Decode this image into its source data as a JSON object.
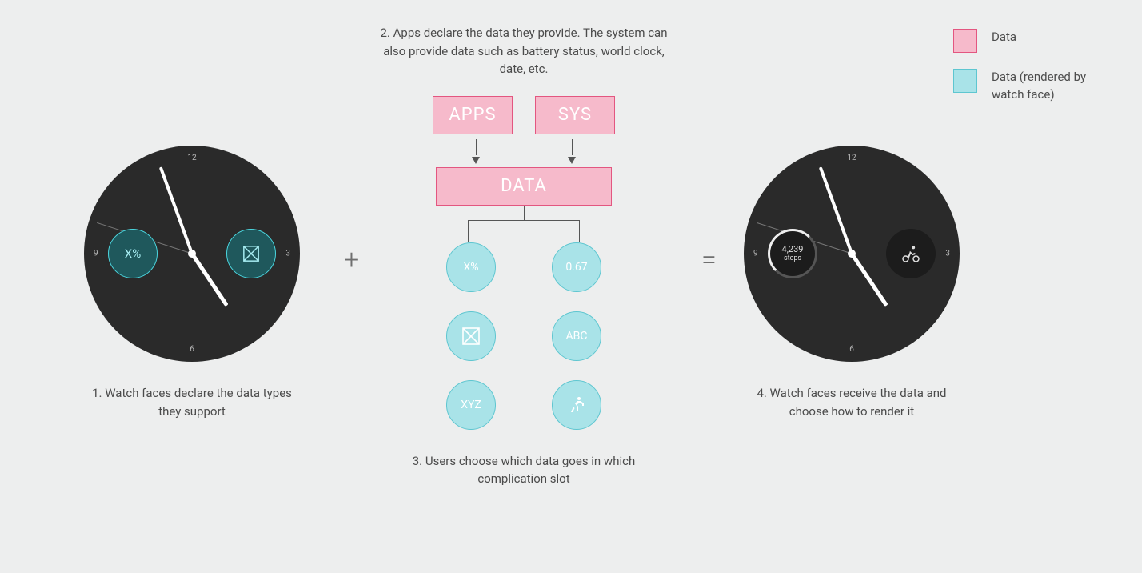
{
  "legend": {
    "pink": "Data",
    "cyan": "Data (rendered by watch face)"
  },
  "stage1": {
    "caption": "1. Watch faces declare the data types they support",
    "watch_numbers": {
      "n12": "12",
      "n3": "3",
      "n6": "6",
      "n9": "9"
    },
    "comp_left": "X%"
  },
  "stage2": {
    "caption_top": "2. Apps declare the data they provide. The system can also provide data such as battery status, world clock, date, etc.",
    "apps": "APPS",
    "sys": "SYS",
    "data": "DATA",
    "bubbles": [
      "X%",
      "0.67",
      "",
      "ABC",
      "XYZ",
      ""
    ],
    "caption_bottom": "3. Users choose which data goes in which complication slot"
  },
  "stage4": {
    "caption": "4. Watch faces receive the data and choose how to render it",
    "watch_numbers": {
      "n12": "12",
      "n3": "3",
      "n6": "6",
      "n9": "9"
    },
    "steps_value": "4,239",
    "steps_label": "steps"
  },
  "ops": {
    "plus": "+",
    "equal": "="
  }
}
